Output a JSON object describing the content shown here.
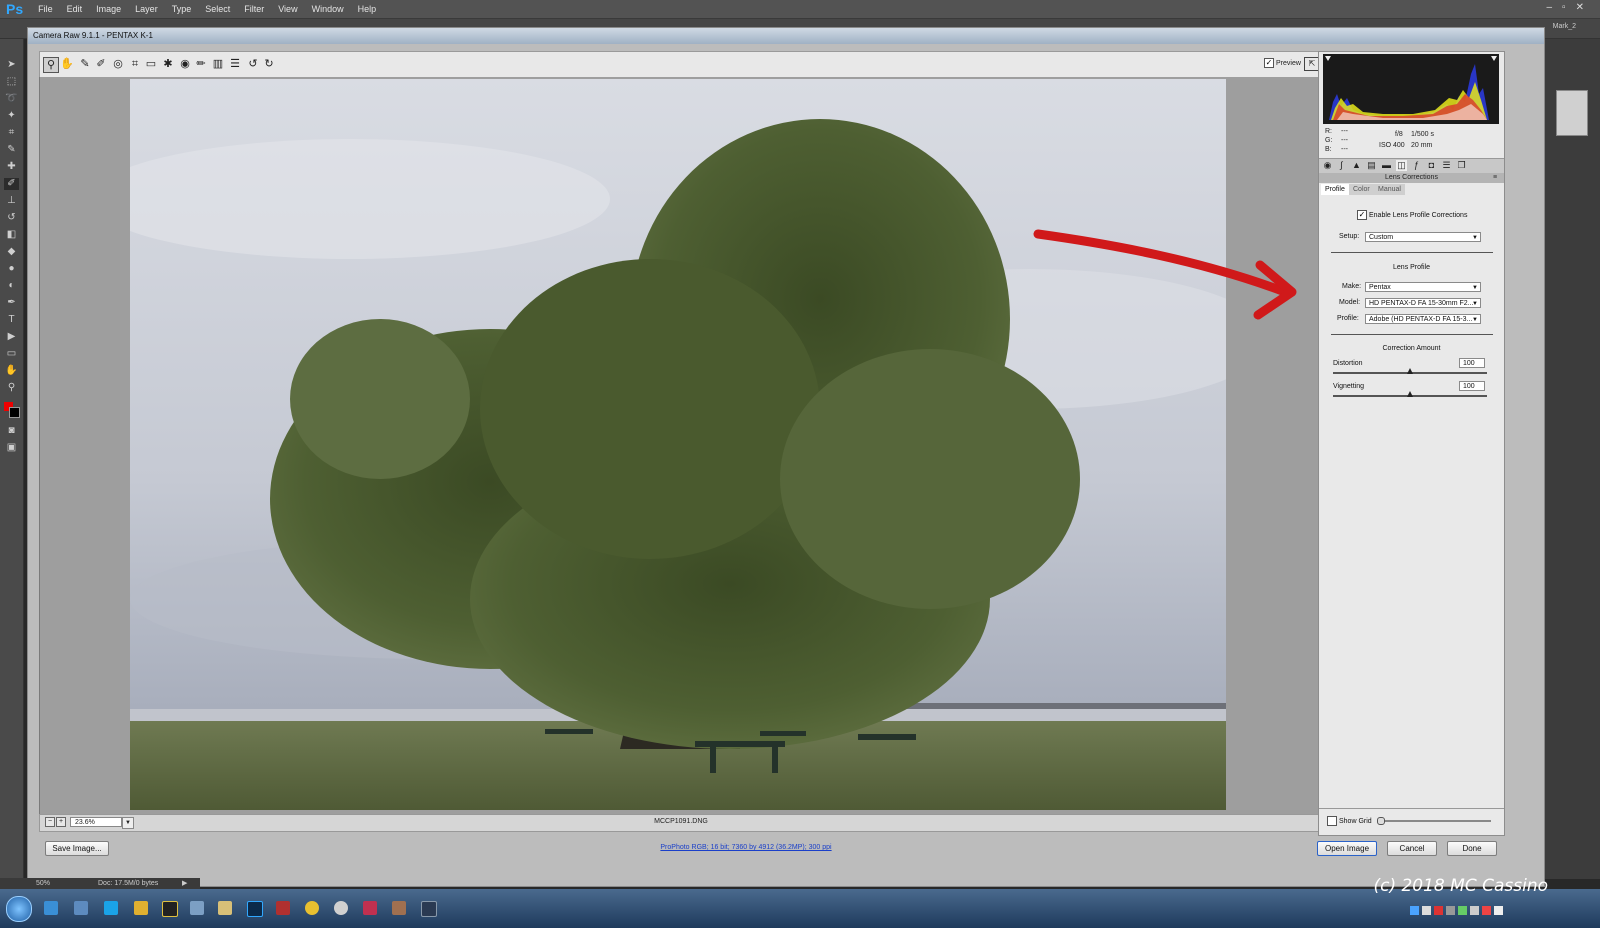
{
  "photoshop": {
    "logo": "Ps",
    "menu": [
      "File",
      "Edit",
      "Image",
      "Layer",
      "Type",
      "Select",
      "Filter",
      "View",
      "Window",
      "Help"
    ],
    "user": "Mark_2",
    "status_zoom": "50%",
    "status_doc": "Doc: 17.5M/0 bytes"
  },
  "acr": {
    "title": "Camera Raw 9.1.1  -  PENTAX K-1",
    "preview_label": "Preview",
    "filename": "MCCP1091.DNG",
    "zoom_value": "23.6%",
    "save_label": "Save Image...",
    "workflow_link": "ProPhoto RGB; 16 bit; 7360 by 4912 (36.2MP); 300 ppi",
    "open_label": "Open Image",
    "cancel_label": "Cancel",
    "done_label": "Done",
    "exif": {
      "r_label": "R:",
      "g_label": "G:",
      "b_label": "B:",
      "r": "---",
      "g": "---",
      "b": "---",
      "aperture": "f/8",
      "shutter": "1/500 s",
      "iso": "ISO 400",
      "focal": "20 mm"
    },
    "panel": {
      "title": "Lens Corrections",
      "tabs": [
        "Profile",
        "Color",
        "Manual"
      ],
      "enable_label": "Enable Lens Profile Corrections",
      "enable_checked": true,
      "setup_label": "Setup:",
      "setup_value": "Custom",
      "lens_profile_heading": "Lens Profile",
      "make_label": "Make:",
      "make_value": "Pentax",
      "model_label": "Model:",
      "model_value": "HD PENTAX-D FA 15-30mm F2...",
      "profile_label": "Profile:",
      "profile_value": "Adobe (HD PENTAX-D FA 15-3...",
      "correction_heading": "Correction Amount",
      "distortion_label": "Distortion",
      "distortion_value": "100",
      "vignetting_label": "Vignetting",
      "vignetting_value": "100",
      "show_grid_label": "Show Grid"
    }
  },
  "watermark": "(c) 2018 MC Cassino",
  "colors": {
    "annotation_arrow": "#d0191a",
    "ps_blue": "#31a8ff",
    "link": "#1a3fc9"
  }
}
